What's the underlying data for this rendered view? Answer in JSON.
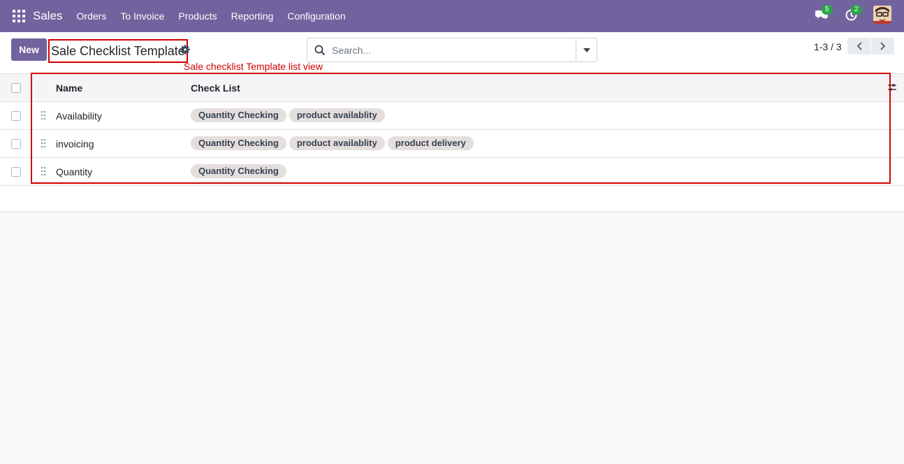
{
  "navbar": {
    "brand": "Sales",
    "menu": [
      "Orders",
      "To Invoice",
      "Products",
      "Reporting",
      "Configuration"
    ],
    "messages_count": "5",
    "activities_count": "2"
  },
  "control": {
    "new_label": "New",
    "title": "Sale Checklist Template",
    "annotation": "Sale checklist Template list view",
    "search_placeholder": "Search...",
    "pager": "1-3 / 3"
  },
  "table": {
    "columns": [
      "Name",
      "Check List"
    ],
    "rows": [
      {
        "name": "Availability",
        "tags": [
          "Quantity Checking",
          "product availablity"
        ]
      },
      {
        "name": "invoicing",
        "tags": [
          "Quantity Checking",
          "product availablity",
          "product delivery"
        ]
      },
      {
        "name": "Quantity",
        "tags": [
          "Quantity Checking"
        ]
      }
    ]
  },
  "colors": {
    "brand": "#71639e",
    "annotation": "#d40000"
  }
}
